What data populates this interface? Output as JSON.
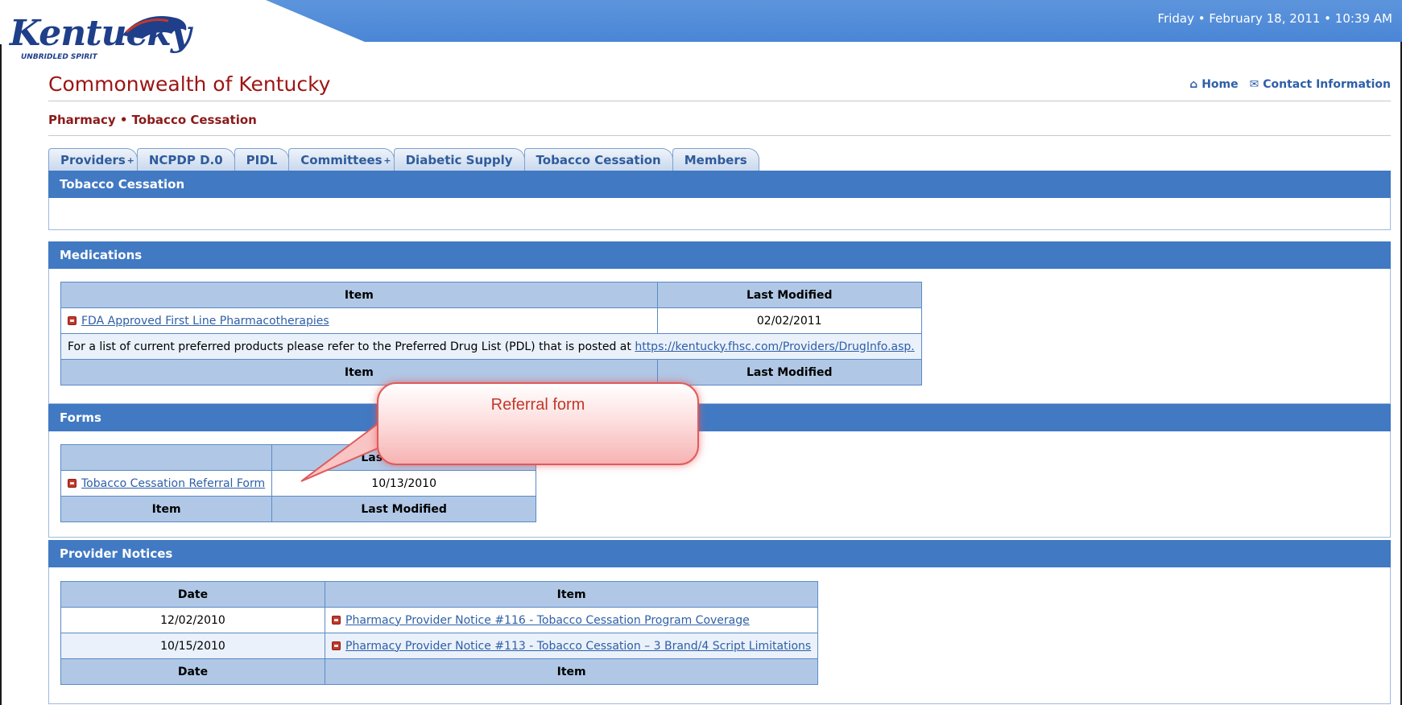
{
  "header": {
    "datetime": "Friday • February 18, 2011 • 10:39 AM",
    "logo_text": "Kentucky",
    "logo_tagline": "UNBRIDLED SPIRIT",
    "site_title": "Commonwealth of Kentucky",
    "home_label": "Home",
    "contact_label": "Contact Information",
    "home_icon": "house-icon",
    "contact_icon": "envelope-icon"
  },
  "breadcrumb": "Pharmacy • Tobacco Cessation",
  "tabs": [
    {
      "label": "Providers",
      "has_plus": true
    },
    {
      "label": "NCPDP D.0",
      "has_plus": false
    },
    {
      "label": "PIDL",
      "has_plus": false
    },
    {
      "label": "Committees",
      "has_plus": true
    },
    {
      "label": "Diabetic Supply",
      "has_plus": false
    },
    {
      "label": "Tobacco Cessation",
      "has_plus": false
    },
    {
      "label": "Members",
      "has_plus": false
    }
  ],
  "page_heading": "Tobacco Cessation",
  "medications": {
    "heading": "Medications",
    "col_item": "Item",
    "col_modified": "Last Modified",
    "rows": [
      {
        "item": "FDA Approved First Line Pharmacotherapies",
        "modified": "02/02/2011"
      }
    ],
    "note_text": "For a list of current preferred products please refer to the Preferred Drug List (PDL) that is posted at ",
    "note_link": "https://kentucky.fhsc.com/Providers/DrugInfo.asp."
  },
  "forms": {
    "heading": "Forms",
    "col_item": "Item",
    "col_modified": "Last Modified",
    "rows": [
      {
        "item": "Tobacco Cessation Referral Form",
        "modified": "10/13/2010"
      }
    ]
  },
  "notices": {
    "heading": "Provider Notices",
    "col_date": "Date",
    "col_item": "Item",
    "rows": [
      {
        "date": "12/02/2010",
        "item": "Pharmacy Provider Notice #116 - Tobacco Cessation Program Coverage"
      },
      {
        "date": "10/15/2010",
        "item": "Pharmacy Provider Notice #113 - Tobacco Cessation – 3 Brand/4 Script Limitations"
      }
    ]
  },
  "callout": {
    "text": "Referral form"
  },
  "colors": {
    "banner": "#4a86d6",
    "section_bar": "#4179c3",
    "title_red": "#9e1414",
    "link": "#2e5fa8",
    "callout_border": "#e05a5a"
  }
}
